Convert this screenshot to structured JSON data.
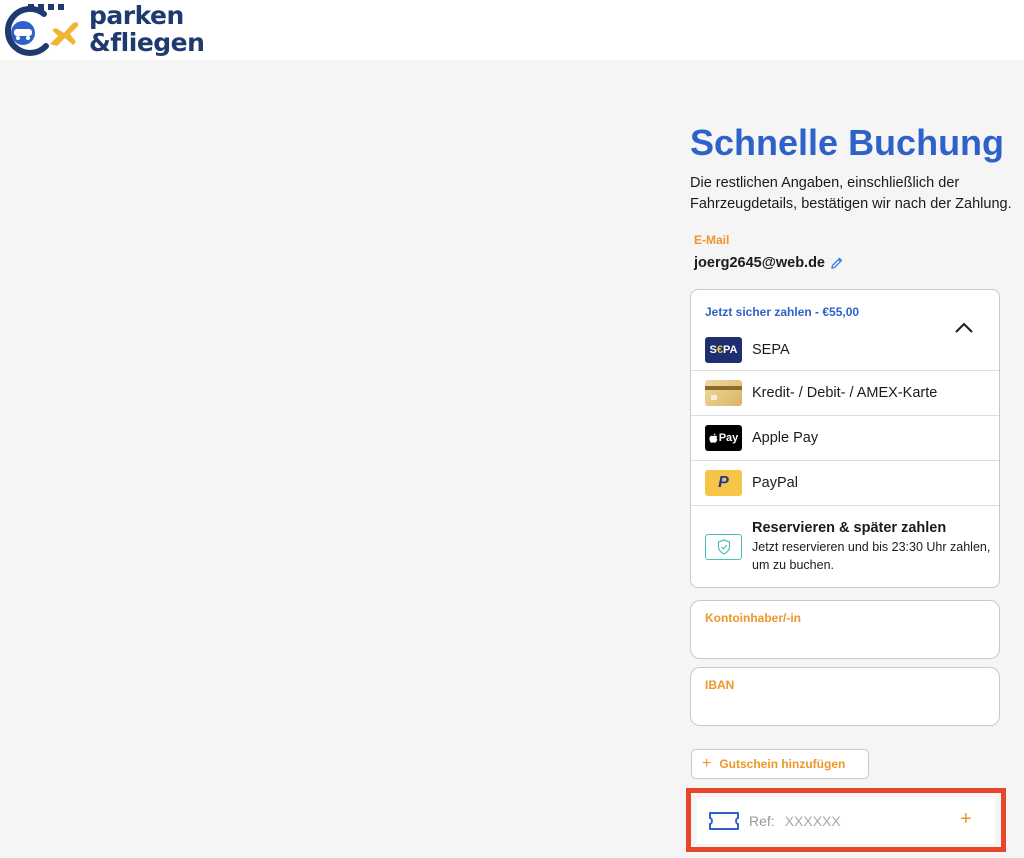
{
  "brand": {
    "line1": "parken",
    "line2": "&fliegen",
    "colors": {
      "navy": "#1f3a6e",
      "plane": "#f1b433",
      "car": "#2f62c9"
    }
  },
  "booking": {
    "title": "Schnelle Buchung",
    "subtitle": "Die restlichen Angaben, einschließlich der Fahrzeugdetails, bestätigen wir nach der Zahlung."
  },
  "email": {
    "label": "E-Mail",
    "value": "joerg2645@web.de",
    "edit_icon": "pencil-icon"
  },
  "payment": {
    "heading": "Jetzt sicher zahlen - €55,00",
    "expanded_icon": "chevron-up-icon",
    "methods": [
      {
        "id": "sepa",
        "label": "SEPA",
        "icon": "sepa-logo-icon",
        "icon_text_1": "S",
        "icon_text_2": "€",
        "icon_text_3": "PA"
      },
      {
        "id": "card",
        "label": "Kredit- / Debit- / AMEX-Karte",
        "icon": "credit-card-icon"
      },
      {
        "id": "apple",
        "label": "Apple Pay",
        "icon": "apple-pay-icon",
        "icon_text": "Pay"
      },
      {
        "id": "paypal",
        "label": "PayPal",
        "icon": "paypal-icon",
        "icon_text": "P"
      },
      {
        "id": "later",
        "label": "Reservieren & später zahlen",
        "description": "Jetzt reservieren und bis 23:30 Uhr zahlen, um zu buchen.",
        "icon": "shield-check-icon"
      }
    ]
  },
  "fields": {
    "account_holder": {
      "label": "Kontoinhaber/-in",
      "value": ""
    },
    "iban": {
      "label": "IBAN",
      "value": ""
    }
  },
  "voucher": {
    "button_label": "Gutschein hinzufügen",
    "plus": "+"
  },
  "ref": {
    "label": "Ref:",
    "placeholder": "XXXXXX",
    "plus": "+",
    "icon": "ticket-icon",
    "highlight_color": "#e8452a"
  },
  "accent_colors": {
    "blue": "#2f62c9",
    "orange": "#f0952b"
  }
}
